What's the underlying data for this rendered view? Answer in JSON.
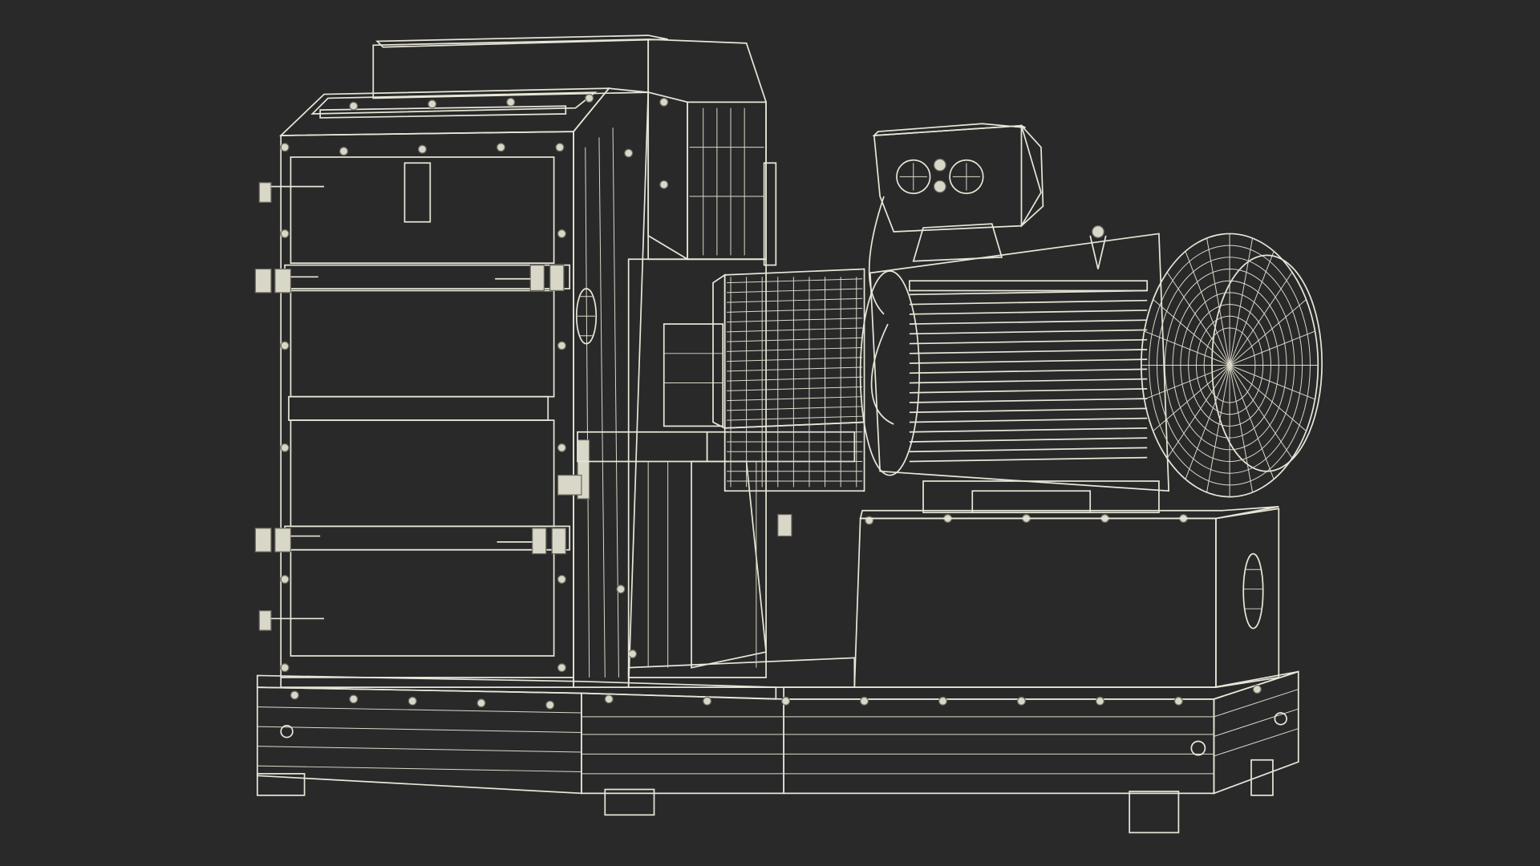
{
  "scene": {
    "subject": "hammer-mill-wireframe",
    "background_color": "#292929",
    "model_fill_color": "#777569",
    "wire_color": "#e8e6d8"
  }
}
